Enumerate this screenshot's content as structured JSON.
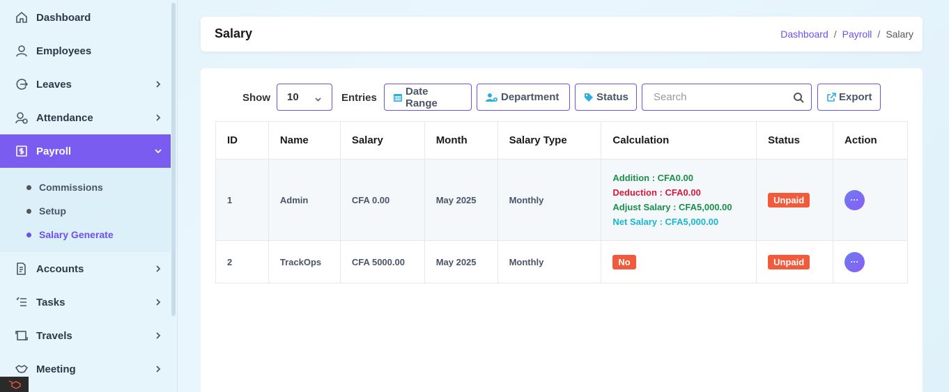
{
  "sidebar": {
    "items": [
      {
        "label": "Dashboard",
        "icon": "home-icon"
      },
      {
        "label": "Employees",
        "icon": "user-icon"
      },
      {
        "label": "Leaves",
        "icon": "leave-icon"
      },
      {
        "label": "Attendance",
        "icon": "attendance-icon"
      },
      {
        "label": "Payroll",
        "icon": "payroll-icon"
      },
      {
        "label": "Accounts",
        "icon": "accounts-icon"
      },
      {
        "label": "Tasks",
        "icon": "tasks-icon"
      },
      {
        "label": "Travels",
        "icon": "travels-icon"
      },
      {
        "label": "Meeting",
        "icon": "handshake-icon"
      }
    ],
    "payroll_sub": [
      {
        "label": "Commissions"
      },
      {
        "label": "Setup"
      },
      {
        "label": "Salary Generate"
      }
    ],
    "accent_color": "#7b5cf0"
  },
  "header": {
    "title": "Salary",
    "breadcrumb": [
      "Dashboard",
      "Payroll",
      "Salary"
    ]
  },
  "toolbar": {
    "show_label": "Show",
    "entries_value": "10",
    "entries_label": "Entries",
    "date_range": "Date Range",
    "department": "Department",
    "status": "Status",
    "search_placeholder": "Search",
    "export": "Export"
  },
  "table": {
    "columns": [
      "ID",
      "Name",
      "Salary",
      "Month",
      "Salary Type",
      "Calculation",
      "Status",
      "Action"
    ],
    "rows": [
      {
        "id": "1",
        "name": "Admin",
        "salary": "CFA 0.00",
        "month": "May 2025",
        "type": "Monthly",
        "calc": {
          "addition": "Addition : CFA0.00",
          "deduction": "Deduction : CFA0.00",
          "adjust": "Adjust Salary : CFA5,000.00",
          "net": "Net Salary : CFA5,000.00"
        },
        "status": "Unpaid"
      },
      {
        "id": "2",
        "name": "TrackOps",
        "salary": "CFA 5000.00",
        "month": "May 2025",
        "type": "Monthly",
        "calc_badge": "No",
        "status": "Unpaid"
      }
    ],
    "colors": {
      "addition": "#1a8f4a",
      "deduction": "#d6173a",
      "adjust": "#1a8f4a",
      "net": "#17b6d4",
      "badge": "#f15a3a"
    }
  }
}
